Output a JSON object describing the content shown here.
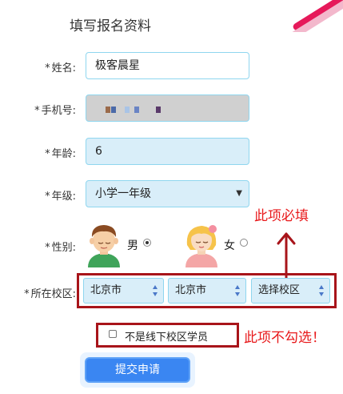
{
  "form": {
    "title": "填写报名资料",
    "name": {
      "label": "姓名:",
      "value": "极客晨星"
    },
    "phone": {
      "label": "手机号:"
    },
    "age": {
      "label": "年龄:",
      "value": "6"
    },
    "grade": {
      "label": "年级:",
      "value": "小学一年级"
    },
    "gender": {
      "label": "性别:",
      "male": "男",
      "female": "女",
      "selected": "男"
    },
    "campus": {
      "label": "所在校区:",
      "province": "北京市",
      "city": "北京市",
      "district": "选择校区"
    },
    "offline_checkbox": {
      "label": "不是线下校区学员",
      "checked": false
    },
    "submit_label": "提交申请",
    "required_mark": "*"
  },
  "annotations": {
    "required_note": "此项必填",
    "dont_check_note": "此项不勾选！"
  },
  "colors": {
    "field_fill": "#d9eef9",
    "field_border": "#8fd6ef",
    "annotation_red": "#e8191b",
    "box_red": "#a8141a",
    "submit_blue": "#3a86f2"
  }
}
